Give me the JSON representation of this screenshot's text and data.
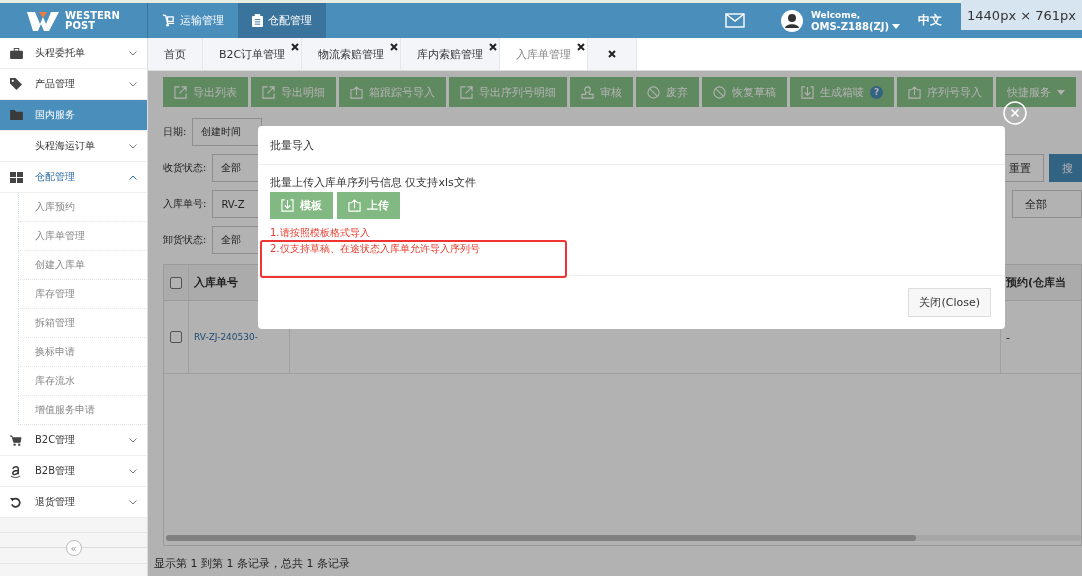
{
  "header": {
    "logo": [
      "WESTERN",
      "POST"
    ],
    "nav": [
      {
        "label": "运输管理",
        "selected": false
      },
      {
        "label": "仓配管理",
        "selected": true
      }
    ],
    "welcome": "Welcome,",
    "user": "OMS-Z188(ZJ)",
    "language": "中文",
    "size_label": "1440px × 761px"
  },
  "sidebar": {
    "items": [
      {
        "label": "头程委托单",
        "selected": false,
        "expanded": false
      },
      {
        "label": "产品管理",
        "selected": false,
        "expanded": false
      },
      {
        "label": "国内服务",
        "selected": true
      },
      {
        "label": "头程海运订单",
        "selected": false,
        "expanded": false
      },
      {
        "label": "仓配管理",
        "selected": false,
        "expanded": true,
        "children": [
          {
            "label": "入库预约",
            "selected": false
          },
          {
            "label": "入库单管理",
            "selected": false
          },
          {
            "label": "创建入库单",
            "selected": false
          },
          {
            "label": "库存管理",
            "selected": false
          },
          {
            "label": "拆箱管理",
            "selected": false
          },
          {
            "label": "换标申请",
            "selected": false
          },
          {
            "label": "库存流水",
            "selected": false
          },
          {
            "label": "增值服务申请",
            "selected": false
          }
        ]
      },
      {
        "label": "B2C管理",
        "selected": false,
        "expanded": false
      },
      {
        "label": "B2B管理",
        "selected": false,
        "expanded": false
      },
      {
        "label": "退货管理",
        "selected": false,
        "expanded": false
      }
    ],
    "collapse_label": "«"
  },
  "tabs": [
    {
      "label": "首页",
      "closable": false,
      "selected": false
    },
    {
      "label": "B2C订单管理",
      "closable": true,
      "selected": false
    },
    {
      "label": "物流索赔管理",
      "closable": true,
      "selected": false
    },
    {
      "label": "库内索赔管理",
      "closable": true,
      "selected": false
    },
    {
      "label": "入库单管理",
      "closable": true,
      "selected": true
    },
    {
      "closable": true,
      "selected": false
    }
  ],
  "toolbar": [
    {
      "label": "导出列表"
    },
    {
      "label": "导出明细"
    },
    {
      "label": "箱跟踪号导入"
    },
    {
      "label": "导出序列号明细"
    },
    {
      "label": "审核"
    },
    {
      "label": "废弃"
    },
    {
      "label": "恢复草稿"
    },
    {
      "label": "生成箱唛",
      "badge": "?"
    },
    {
      "label": "序列号导入"
    },
    {
      "label": "快捷服务",
      "dropdown": true
    }
  ],
  "filters": [
    {
      "label": "日期:",
      "value": "创建时间"
    },
    {
      "label": "收货状态:",
      "value": "全部",
      "side": [
        {
          "kind": "button",
          "label": "重置"
        },
        {
          "kind": "primary",
          "label": "搜"
        }
      ]
    },
    {
      "label": "入库单号:",
      "value": "RV-Z",
      "side": [
        {
          "kind": "select",
          "label": "全部"
        }
      ]
    },
    {
      "label": "卸货状态:",
      "value": "全部"
    }
  ],
  "table": {
    "header_checked": false,
    "columns": [
      "入库单号",
      "预约(仓库当"
    ],
    "rows": [
      {
        "checked": false,
        "cells": [
          "RV-ZJ-240530-",
          "-"
        ]
      }
    ]
  },
  "footer": "显示第 1 到第 1 条记录，总共 1 条记录",
  "modal": {
    "title": "批量导入",
    "description": "批量上传入库单序列号信息 仅支持xls文件",
    "buttons": [
      {
        "label": "模板"
      },
      {
        "label": "上传"
      }
    ],
    "notes": [
      "1.请按照模板格式导入",
      "2.仅支持草稿、在途状态入库单允许导入序列号"
    ],
    "close_label": "关闭(Close)"
  }
}
